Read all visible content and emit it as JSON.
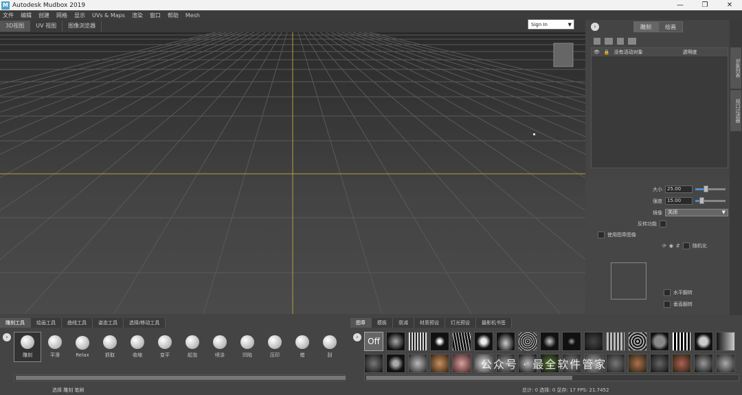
{
  "window": {
    "title": "Autodesk Mudbox 2019",
    "icon": "M",
    "min": "—",
    "max": "❐",
    "close": "✕"
  },
  "menu": [
    "文件",
    "编辑",
    "创建",
    "网格",
    "显示",
    "UVs & Maps",
    "渲染",
    "窗口",
    "帮助",
    "Mesh"
  ],
  "view_tabs": [
    "3D视图",
    "UV 视图",
    "图像浏览器"
  ],
  "signin": {
    "label": "Sign In"
  },
  "right_panel": {
    "tabs": [
      "雕刻",
      "绘画"
    ],
    "layers_header": [
      "没有活动对象",
      "透明度"
    ],
    "side_tabs": [
      "对象列表",
      "视口过滤器"
    ]
  },
  "props": {
    "size_label": "大小",
    "size_value": "25.00",
    "size_fraction": 0.35,
    "strength_label": "强度",
    "strength_value": "15.00",
    "strength_fraction": 0.2,
    "mirror_label": "镜像",
    "mirror_value": "关闭",
    "invert_label": "反转功能",
    "stamp_label": "使用图章图像",
    "random_label": "随机化",
    "horiz_flip": "水平翻转",
    "vert_flip": "垂直翻转"
  },
  "sculpt_tabs": [
    "雕刻工具",
    "绘画工具",
    "曲线工具",
    "姿态工具",
    "选择/移动工具"
  ],
  "sculpt_tools": [
    "雕刻",
    "平滑",
    "Relax",
    "抓取",
    "收缩",
    "变平",
    "起泡",
    "喷涂",
    "凹陷",
    "压印",
    "蜡",
    "刮"
  ],
  "stamp_tabs": [
    "图章",
    "模板",
    "衰减",
    "材质预设",
    "灯光预设",
    "摄影机书签"
  ],
  "stamp_off": "Off",
  "status_left": "选择 雕刻 笔刷",
  "status_right": "总计: 0  选择: 0  显存: 17  FPS: 21.7452",
  "watermark": "公众号 · 最全软件管家",
  "colors": {
    "accent": "#4a8fd0",
    "grid_axis": "#b8a040"
  }
}
